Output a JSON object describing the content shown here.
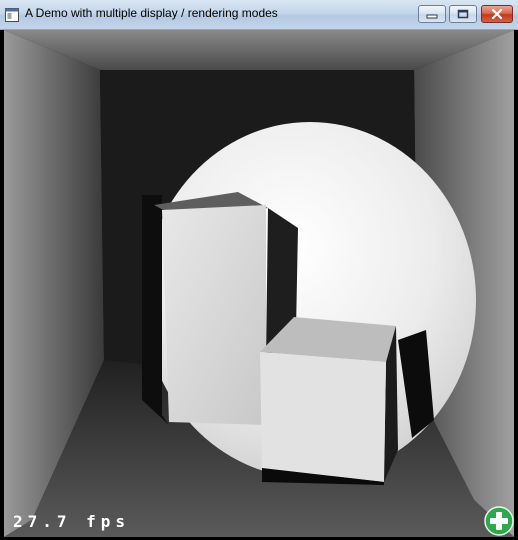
{
  "window": {
    "title": "A Demo with multiple display / rendering modes",
    "icons": {
      "app": "app-window-icon",
      "minimize": "minimize-icon",
      "maximize": "maximize-icon",
      "close": "close-icon"
    }
  },
  "overlay": {
    "fps_text": "27.7 fps",
    "add_icon": "plus-circle-icon",
    "add_color": "#2fa84a"
  }
}
